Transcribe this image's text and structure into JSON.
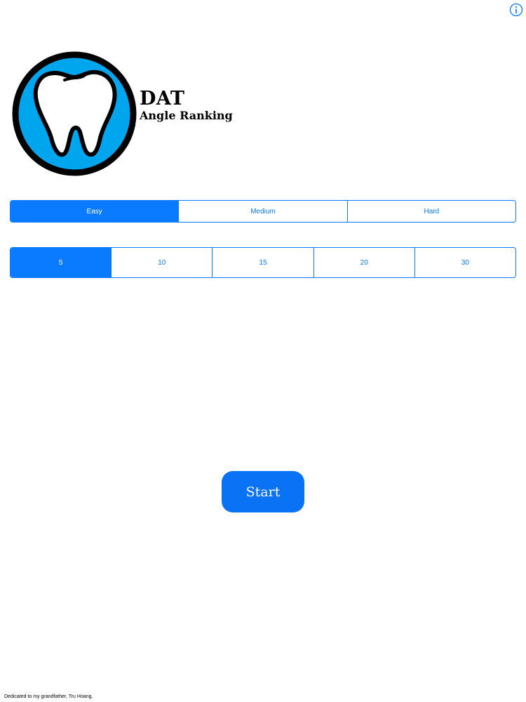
{
  "brand": {
    "title": "DAT",
    "subtitle": "Angle Ranking",
    "logo_icon": "tooth-icon",
    "logo_color": "#00a6ed"
  },
  "header": {
    "info_icon": "info-icon"
  },
  "difficulty": {
    "options": [
      "Easy",
      "Medium",
      "Hard"
    ],
    "selected": "Easy"
  },
  "count": {
    "options": [
      "5",
      "10",
      "15",
      "20",
      "30"
    ],
    "selected": "5"
  },
  "start_button": {
    "label": "Start"
  },
  "footer": {
    "dedication": "Dedicated to my grandfather, Tru Hoang."
  },
  "colors": {
    "accent": "#0a7aff",
    "background": "#ffffff"
  }
}
